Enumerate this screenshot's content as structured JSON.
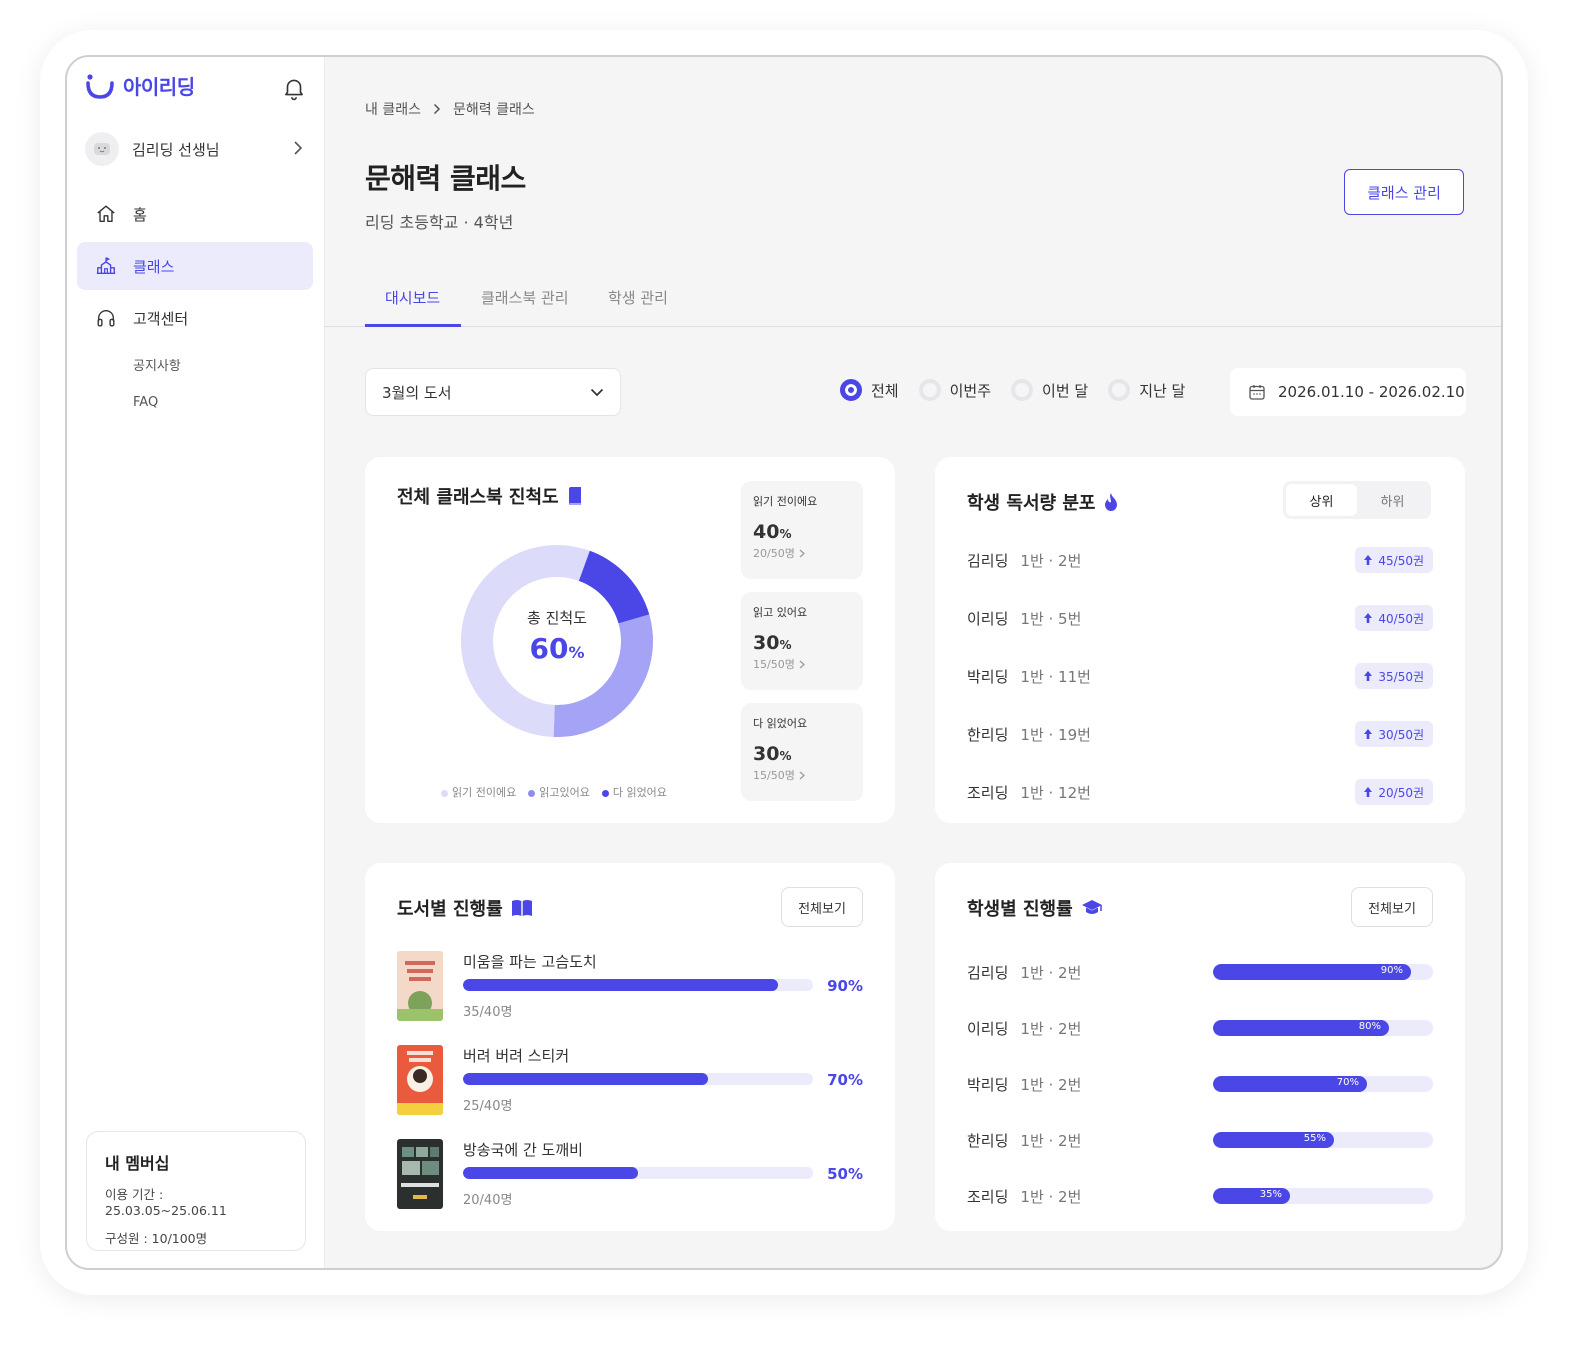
{
  "app": {
    "logo_text": "아이리딩"
  },
  "sidebar": {
    "profile_name": "김리딩 선생님",
    "nav": [
      {
        "label": "홈",
        "icon": "home-icon"
      },
      {
        "label": "클래스",
        "icon": "school-icon"
      },
      {
        "label": "고객센터",
        "icon": "headset-icon"
      }
    ],
    "sub_nav": [
      "공지사항",
      "FAQ"
    ],
    "membership": {
      "title": "내 멤버십",
      "period": "이용 기간 : 25.03.05~25.06.11",
      "members": "구성원 : 10/100명"
    }
  },
  "header": {
    "breadcrumb": [
      "내 클래스",
      "문해력 클래스"
    ],
    "title": "문해력 클래스",
    "subtitle": "리딩 초등학교 · 4학년",
    "manage_button": "클래스 관리",
    "tabs": [
      "대시보드",
      "클래스북 관리",
      "학생 관리"
    ]
  },
  "filters": {
    "book_select": "3월의 도서",
    "periods": [
      "전체",
      "이번주",
      "이번 달",
      "지난 달"
    ],
    "selected_period": "전체",
    "date_range": "2026.01.10 - 2026.02.10"
  },
  "progress_card": {
    "title": "전체 클래스북 진척도",
    "center_label": "총 진척도",
    "center_value": "60",
    "center_unit": "%",
    "stats": [
      {
        "label": "읽기 전이에요",
        "value": "40",
        "unit": "%",
        "count": "20/50명"
      },
      {
        "label": "읽고 있어요",
        "value": "30",
        "unit": "%",
        "count": "15/50명"
      },
      {
        "label": "다 읽었어요",
        "value": "30",
        "unit": "%",
        "count": "15/50명"
      }
    ],
    "legend": [
      "읽기 전이에요",
      "읽고있어요",
      "다 읽었어요"
    ],
    "segments": [
      {
        "label": "읽기 전이에요",
        "fraction": 0.4,
        "color": "#dcdcfa"
      },
      {
        "label": "읽고있어요",
        "fraction": 0.3,
        "color": "#a5a3f5"
      },
      {
        "label": "다 읽었어요",
        "fraction": 0.15,
        "color": "#4b47e6"
      }
    ]
  },
  "distribution_card": {
    "title": "학생 독서량 분포",
    "toggle": [
      "상위",
      "하위"
    ],
    "rows": [
      {
        "name": "김리딩",
        "class": "1반 · 2번",
        "badge": "45/50권"
      },
      {
        "name": "이리딩",
        "class": "1반 · 5번",
        "badge": "40/50권"
      },
      {
        "name": "박리딩",
        "class": "1반 · 11번",
        "badge": "35/50권"
      },
      {
        "name": "한리딩",
        "class": "1반 · 19번",
        "badge": "30/50권"
      },
      {
        "name": "조리딩",
        "class": "1반 · 12번",
        "badge": "20/50권"
      }
    ]
  },
  "book_card": {
    "title": "도서별 진행률",
    "view_all": "전체보기",
    "books": [
      {
        "title": "미움을 파는 고슴도치",
        "percent": 90,
        "percent_label": "90%",
        "count": "35/40명",
        "cover_color": "#f4d9c8"
      },
      {
        "title": "버려 버려 스티커",
        "percent": 70,
        "percent_label": "70%",
        "count": "25/40명",
        "cover_color": "#e95b3c"
      },
      {
        "title": "방송국에 간 도깨비",
        "percent": 50,
        "percent_label": "50%",
        "count": "20/40명",
        "cover_color": "#2b2f2e"
      }
    ]
  },
  "student_card": {
    "title": "학생별 진행률",
    "view_all": "전체보기",
    "rows": [
      {
        "name": "김리딩",
        "class": "1반 · 2번",
        "percent": 90,
        "percent_label": "90%"
      },
      {
        "name": "이리딩",
        "class": "1반 · 2번",
        "percent": 80,
        "percent_label": "80%"
      },
      {
        "name": "박리딩",
        "class": "1반 · 2번",
        "percent": 70,
        "percent_label": "70%"
      },
      {
        "name": "한리딩",
        "class": "1반 · 2번",
        "percent": 55,
        "percent_label": "55%"
      },
      {
        "name": "조리딩",
        "class": "1반 · 2번",
        "percent": 35,
        "percent_label": "35%"
      }
    ]
  },
  "colors": {
    "accent": "#4b47e6",
    "accent_light": "#ebebfc",
    "bg": "#f5f5f6"
  }
}
